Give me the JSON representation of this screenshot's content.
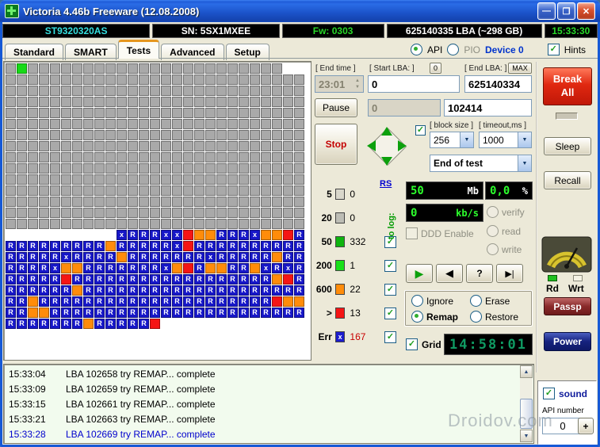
{
  "titlebar": {
    "title": "Victoria 4.46b Freeware (12.08.2008)",
    "icons": {
      "minimize": "—",
      "maximize": "❐",
      "close": "✕"
    }
  },
  "infobar": {
    "model": "ST9320320AS",
    "serial": "SN: 5SX1MXEE",
    "firmware": "Fw: 0303",
    "capacity": "625140335 LBA (~298 GB)",
    "clock": "15:33:30",
    "colors": {
      "model": "#35e0e0",
      "serial": "#ffffff",
      "firmware": "#28d828",
      "capacity": "#ffffff",
      "clock": "#28d828"
    }
  },
  "tabbar": {
    "tabs": [
      "Standard",
      "SMART",
      "Tests",
      "Advanced",
      "Setup"
    ],
    "active_tab": "Tests",
    "api_label": "API",
    "pio_label": "PIO",
    "device_label": "Device 0",
    "hints_label": "Hints"
  },
  "controls": {
    "end_time_label": "[ End time ]",
    "end_time_value": "23:01",
    "start_lba_label": "[ Start LBA: ]",
    "start_lba_reset": "0",
    "start_lba_value": "0",
    "end_lba_label": "[ End LBA: ]",
    "max_button": "MAX",
    "end_lba_value": "625140334",
    "pause_button": "Pause",
    "aux_value": "0",
    "current_lba": "102414",
    "block_size_label": "[ block size ]",
    "block_size_value": "256",
    "timeout_label": "[ timeout,ms ]",
    "timeout_value": "1000",
    "stop_button": "Stop",
    "end_of_test_value": "End of test"
  },
  "legend": {
    "rs_link": "RS",
    "to_log_label": "to log:",
    "rows": [
      {
        "label": "5",
        "count": "0",
        "color": "#d9d7cb",
        "checkbox": false,
        "x_mark": false
      },
      {
        "label": "20",
        "count": "0",
        "color": "#bdbdb5",
        "checkbox": false,
        "x_mark": false
      },
      {
        "label": "50",
        "count": "332",
        "color": "#0fb40f",
        "checkbox": true,
        "x_mark": false
      },
      {
        "label": "200",
        "count": "1",
        "color": "#19e019",
        "checkbox": true,
        "x_mark": false
      },
      {
        "label": "600",
        "count": "22",
        "color": "#ff8c0a",
        "checkbox": true,
        "x_mark": false
      },
      {
        "label": ">",
        "count": "13",
        "color": "#f51515",
        "checkbox": true,
        "x_mark": false
      },
      {
        "label": "Err",
        "count": "167",
        "color": "#1c1ccd",
        "checkbox": true,
        "x_mark": true,
        "count_color": "#c80000"
      }
    ]
  },
  "speed_panel": {
    "mb_value": "50",
    "mb_label": "Mb",
    "percent_value": "0,0",
    "percent_label": "%",
    "kbs_value": "0",
    "kbs_label": "kb/s",
    "verify_label": "verify",
    "ddd_label": "DDD Enable",
    "read_label": "read",
    "write_label": "write",
    "play_icon": "▶",
    "back_icon": "◀",
    "seek_icon": "?",
    "end_icon": "▶|"
  },
  "modes": {
    "options": [
      "Ignore",
      "Erase",
      "Remap",
      "Restore"
    ],
    "selected": "Remap"
  },
  "grid_bar": {
    "grid_label": "Grid",
    "time_lcd": "14:58:01"
  },
  "side_panel": {
    "break_all": "Break All",
    "sleep": "Sleep",
    "recall": "Recall",
    "rd_label": "Rd",
    "wrt_label": "Wrt",
    "passp": "Passp",
    "power": "Power",
    "sound_label": "sound",
    "api_number_label": "API number",
    "api_number_value": "0",
    "plus_button": "+"
  },
  "test_grid": {
    "cols": 27,
    "cell_colors": {
      "g": "#a9a9a9",
      "G": "#17da17",
      "R": "#1717c8",
      "x": "#1717c8",
      "o": "#ff8c0a",
      "r": "#f51515"
    },
    "cell_letters": {
      "R": "R",
      "x": "x"
    },
    "rows": [
      "gGggggggggggggggggggggggg14",
      "ggggggggggggggggggggggggggg",
      "ggggggggggggggggggggggggggg",
      "ggggggggggggggggggggggggggg",
      "ggggggggggggggggggggggggggg",
      "ggggggggggggggggggggggggggg",
      "ggggggggggggggggggggggggggg",
      "ggggggggggggggggggggggggggg",
      "ggggggggggggggggggggggggggg",
      "ggggggggggggggggggggggggggg",
      "ggggggggggggggggggggggggggg",
      "ggggggggggggggggggggggggggg",
      "ggggggggggggggggggggggggggg",
      "ggggggggggggggggggggggggggg",
      "ggggggggggggggggggggggggggg",
      "__________xRRRxxrooRRRxoorR",
      "RRRRRRRRRoRRRRRxrRRRRRRRRRR",
      "RRRRRxRRRRoRRRRRRRxRRRRRoRR",
      "RRRRxooRRRRRRRxorRooRRoxRxR",
      "RRRRRrRRRRRRRRRRRRRRRRRRorR",
      "RRRRRRoRRRRRRRRRRRRRRRRRRRR",
      "RRoRRRRRRRRRRRRRRRRRRRRRroo",
      "RRooRRRRRRRRRRRRRRRRRRRRRRR",
      "RRRRRRRoRRRRRr_____________"
    ]
  },
  "log": {
    "lines": [
      {
        "time": "15:33:04",
        "text": "LBA 102658 try REMAP... complete"
      },
      {
        "time": "15:33:09",
        "text": "LBA 102659 try REMAP... complete"
      },
      {
        "time": "15:33:15",
        "text": "LBA 102661 try REMAP... complete"
      },
      {
        "time": "15:33:21",
        "text": "LBA 102663 try REMAP... complete"
      },
      {
        "time": "15:33:28",
        "text": "LBA 102669 try REMAP... complete"
      }
    ],
    "highlight_last": true
  },
  "watermark": "Droidov.com"
}
